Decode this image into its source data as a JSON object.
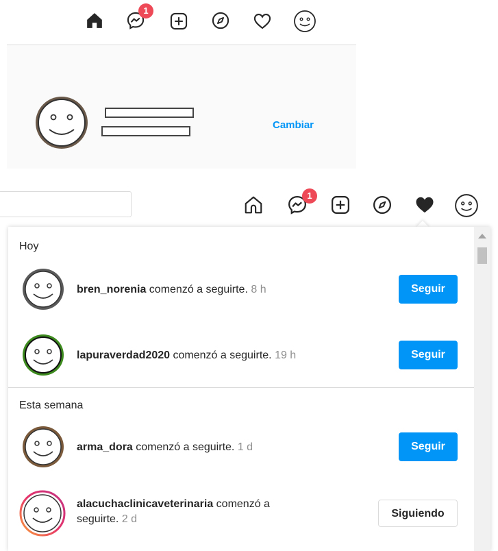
{
  "top_nav": {
    "messenger_badge": "1",
    "icons": [
      "home-filled-icon",
      "messenger-icon",
      "new-post-icon",
      "explore-icon",
      "activity-heart-icon",
      "profile-avatar-icon"
    ]
  },
  "profile_card": {
    "change_label": "Cambiar"
  },
  "second_nav": {
    "messenger_badge": "1",
    "search_value": ""
  },
  "activity": {
    "sections": [
      {
        "title": "Hoy",
        "items": [
          {
            "username": "bren_norenia",
            "action": " comenzó a seguirte.",
            "time": "8 h",
            "button": "Seguir"
          },
          {
            "username": "lapuraverdad2020",
            "action": " comenzó a seguirte.",
            "time": "19 h",
            "button": "Seguir"
          }
        ]
      },
      {
        "title": "Esta semana",
        "items": [
          {
            "username": "arma_dora",
            "action": " comenzó a seguirte.",
            "time": "1 d",
            "button": "Seguir"
          },
          {
            "username": "alacuchaclinicaveterinaria",
            "action": " comenzó a",
            "action2": "seguirte.",
            "time": "2 d",
            "button": "Siguiendo"
          }
        ]
      }
    ]
  },
  "colors": {
    "accent": "#0095f6",
    "badge": "#ed4956",
    "text": "#262626",
    "muted": "#8e8e8e"
  }
}
